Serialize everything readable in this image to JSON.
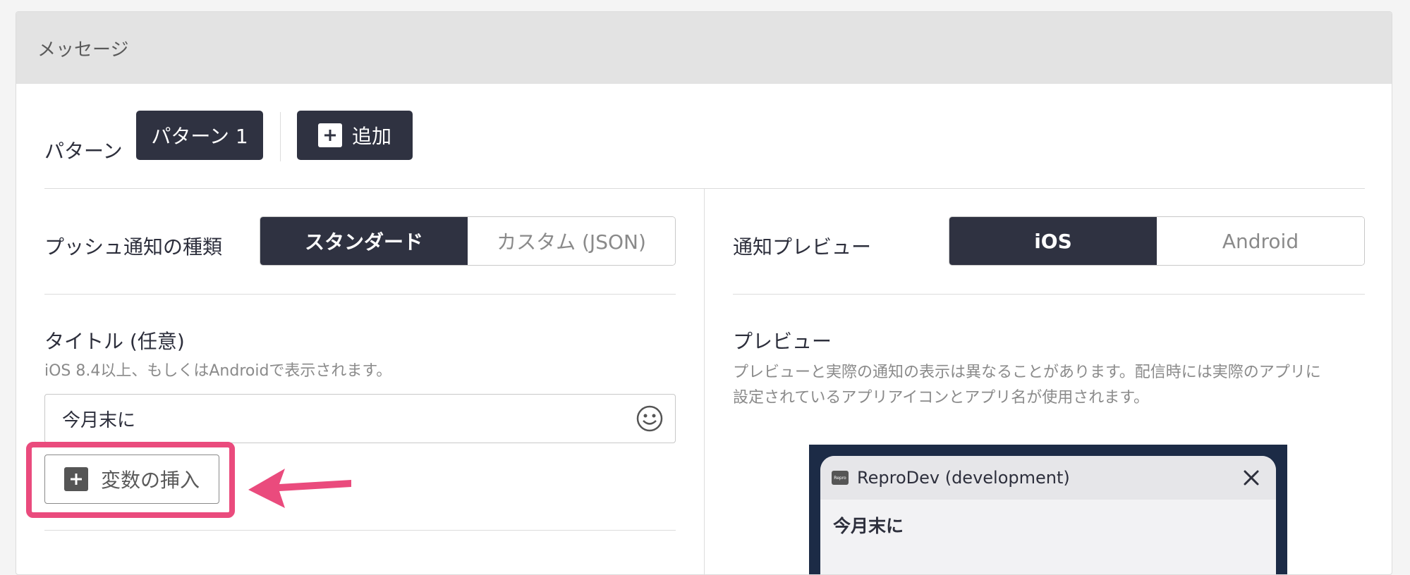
{
  "card": {
    "header_title": "メッセージ"
  },
  "pattern": {
    "label": "パターン",
    "selected_pattern": "パターン 1",
    "add_label": "追加"
  },
  "push_type": {
    "label": "プッシュ通知の種類",
    "options": [
      "スタンダード",
      "カスタム (JSON)"
    ],
    "selected": "スタンダード"
  },
  "notification_preview": {
    "label": "通知プレビュー",
    "options": [
      "iOS",
      "Android"
    ],
    "selected": "iOS"
  },
  "title_field": {
    "label": "タイトル (任意)",
    "help": "iOS 8.4以上、もしくはAndroidで表示されます。",
    "value": "今月末に"
  },
  "insert_variable": {
    "label": "変数の挿入"
  },
  "preview": {
    "heading": "プレビュー",
    "description_line1": "プレビューと実際の通知の表示は異なることがあります。配信時には実際のアプリに",
    "description_line2": "設定されているアプリアイコンとアプリ名が使用されます。",
    "app_name": "ReproDev (development)",
    "app_icon_text": "Repro",
    "notification_title": "今月末に"
  },
  "colors": {
    "dark_button": "#2f3241",
    "highlight": "#ea4b7d",
    "phone_background": "#1c2b46"
  },
  "icons": [
    "plus-icon",
    "emoji-icon",
    "arrow-icon",
    "close-icon",
    "app-icon"
  ]
}
